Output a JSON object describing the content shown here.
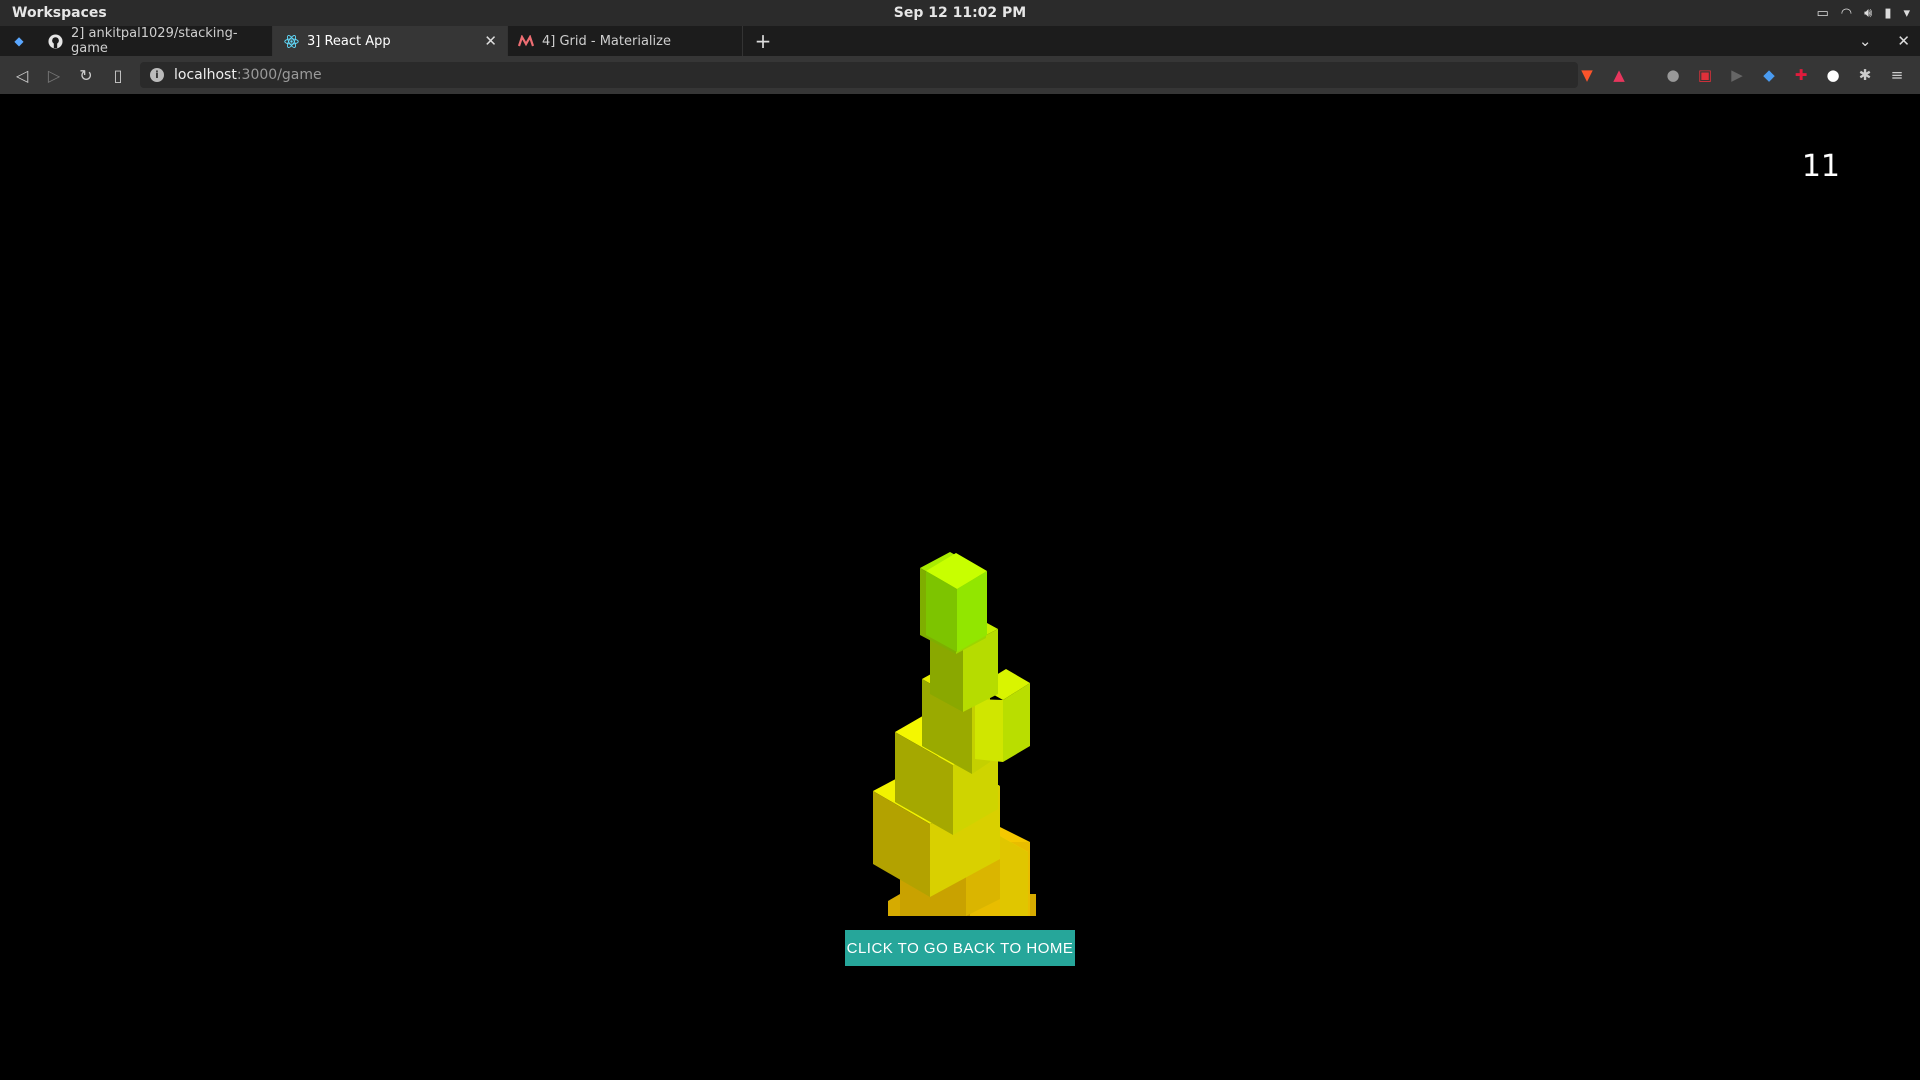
{
  "system": {
    "workspaces_label": "Workspaces",
    "clock": "Sep 12  11:02 PM"
  },
  "tabs": [
    {
      "label": "2] ankitpal1029/stacking-game",
      "icon": "github-icon",
      "active": false
    },
    {
      "label": "3] React App",
      "icon": "react-icon",
      "active": true
    },
    {
      "label": "4] Grid - Materialize",
      "icon": "materialize-icon",
      "active": false
    }
  ],
  "address": {
    "host": "localhost",
    "path": ":3000/game"
  },
  "game": {
    "score": "11",
    "home_button_label": "CLICK TO GO BACK TO HOME"
  }
}
